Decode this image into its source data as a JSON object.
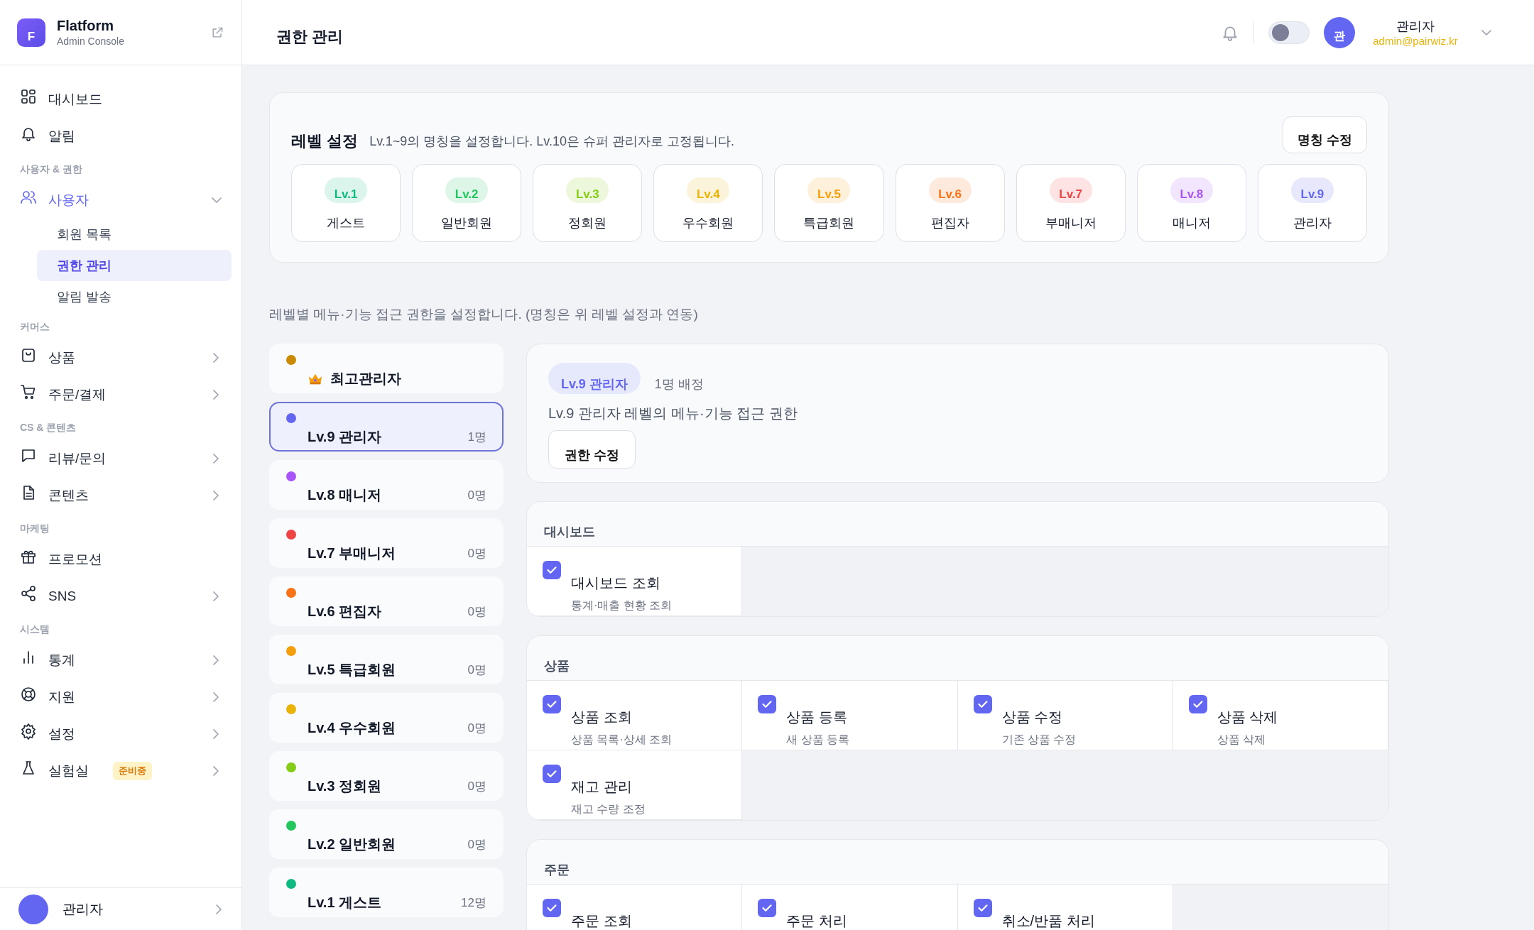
{
  "sidebar": {
    "brand": {
      "logo": "F",
      "name": "Flatform",
      "subtitle": "Admin Console"
    },
    "groups": [
      {
        "items": [
          {
            "label": "대시보드",
            "active": false
          },
          {
            "label": "알림",
            "active": false
          }
        ]
      },
      {
        "label": "사용자 & 권한",
        "items": [
          {
            "label": "사용자",
            "active": true,
            "expanded": true,
            "children": [
              {
                "label": "회원 목록",
                "selected": false
              },
              {
                "label": "권한 관리",
                "selected": true
              },
              {
                "label": "알림 발송",
                "selected": false
              }
            ]
          }
        ]
      },
      {
        "label": "커머스",
        "items": [
          {
            "label": "상품",
            "active": false,
            "expanded": false
          },
          {
            "label": "주문/결제",
            "active": false,
            "expanded": false
          }
        ]
      },
      {
        "label": "CS & 콘텐츠",
        "items": [
          {
            "label": "리뷰/문의",
            "active": false,
            "expanded": false
          },
          {
            "label": "콘텐츠",
            "active": false,
            "expanded": false
          }
        ]
      },
      {
        "label": "마케팅",
        "items": [
          {
            "label": "프로모션",
            "active": false
          },
          {
            "label": "SNS",
            "active": false,
            "expanded": false
          }
        ]
      },
      {
        "label": "시스템",
        "items": [
          {
            "label": "통계",
            "active": false,
            "expanded": false
          },
          {
            "label": "지원",
            "active": false,
            "expanded": false
          },
          {
            "label": "설정",
            "active": false,
            "expanded": false
          },
          {
            "label": "실험실",
            "active": false,
            "expanded": false,
            "badge": "준비중"
          }
        ]
      }
    ],
    "footer": {
      "name": "관리자"
    }
  },
  "header": {
    "title": "권한 관리",
    "dark_mode": {
      "on": false
    },
    "user": {
      "avatar": "관",
      "name": "관리자",
      "email": "admin@pairwiz.kr"
    }
  },
  "level_settings": {
    "title": "레벨 설정",
    "description": "Lv.1~9의 명칭을 설정합니다. Lv.10은 슈퍼 관리자로 고정됩니다.",
    "button": "명칭 수정",
    "levels": [
      {
        "label": "Lv.1",
        "name": "게스트",
        "color": "#10b981"
      },
      {
        "label": "Lv.2",
        "name": "일반회원",
        "color": "#22c55e"
      },
      {
        "label": "Lv.3",
        "name": "정회원",
        "color": "#84cc16"
      },
      {
        "label": "Lv.4",
        "name": "우수회원",
        "color": "#eab308"
      },
      {
        "label": "Lv.5",
        "name": "특급회원",
        "color": "#f59e0b"
      },
      {
        "label": "Lv.6",
        "name": "편집자",
        "color": "#f97316"
      },
      {
        "label": "Lv.7",
        "name": "부매니저",
        "color": "#ef4444"
      },
      {
        "label": "Lv.8",
        "name": "매니저",
        "color": "#a855f7"
      },
      {
        "label": "Lv.9",
        "name": "관리자",
        "color": "#6366f1"
      }
    ]
  },
  "permissions_intro": "레벨별 메뉴·기능 접근 권한을 설정합니다. (명칭은 위 레벨 설정과 연동)",
  "roles": [
    {
      "kind": "super",
      "label": "최고관리자",
      "color": "#ca8a04",
      "selected": false
    },
    {
      "kind": "level",
      "label": "Lv.9 관리자",
      "count": "1명",
      "color": "#6366f1",
      "selected": true
    },
    {
      "kind": "level",
      "label": "Lv.8 매니저",
      "count": "0명",
      "color": "#a855f7",
      "selected": false
    },
    {
      "kind": "level",
      "label": "Lv.7 부매니저",
      "count": "0명",
      "color": "#ef4444",
      "selected": false
    },
    {
      "kind": "level",
      "label": "Lv.6 편집자",
      "count": "0명",
      "color": "#f97316",
      "selected": false
    },
    {
      "kind": "level",
      "label": "Lv.5 특급회원",
      "count": "0명",
      "color": "#f59e0b",
      "selected": false
    },
    {
      "kind": "level",
      "label": "Lv.4 우수회원",
      "count": "0명",
      "color": "#eab308",
      "selected": false
    },
    {
      "kind": "level",
      "label": "Lv.3 정회원",
      "count": "0명",
      "color": "#84cc16",
      "selected": false
    },
    {
      "kind": "level",
      "label": "Lv.2 일반회원",
      "count": "0명",
      "color": "#22c55e",
      "selected": false
    },
    {
      "kind": "level",
      "label": "Lv.1 게스트",
      "count": "12명",
      "color": "#10b981",
      "selected": false
    }
  ],
  "detail": {
    "badge": "Lv.9 관리자",
    "assigned": "1명 배정",
    "description": "Lv.9 관리자 레벨의 메뉴·기능 접근 권한",
    "button": "권한 수정"
  },
  "sections": [
    {
      "title": "대시보드",
      "permissions": [
        {
          "name": "대시보드 조회",
          "description": "통계·매출 현황 조회",
          "checked": true
        }
      ]
    },
    {
      "title": "상품",
      "permissions": [
        {
          "name": "상품 조회",
          "description": "상품 목록·상세 조회",
          "checked": true
        },
        {
          "name": "상품 등록",
          "description": "새 상품 등록",
          "checked": true
        },
        {
          "name": "상품 수정",
          "description": "기존 상품 수정",
          "checked": true
        },
        {
          "name": "상품 삭제",
          "description": "상품 삭제",
          "checked": true
        },
        {
          "name": "재고 관리",
          "description": "재고 수량 조정",
          "checked": true
        }
      ]
    },
    {
      "title": "주문",
      "permissions": [
        {
          "name": "주문 조회",
          "checked": true
        },
        {
          "name": "주문 처리",
          "checked": true
        },
        {
          "name": "취소/반품 처리",
          "checked": true
        }
      ]
    }
  ]
}
